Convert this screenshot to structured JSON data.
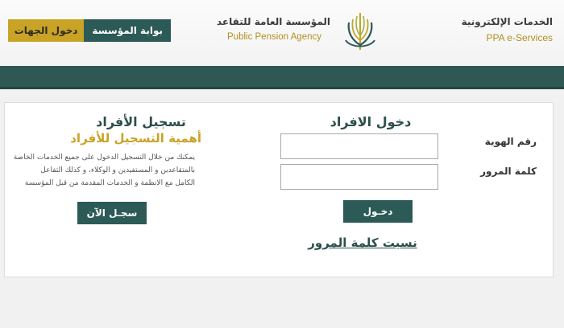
{
  "header": {
    "portal_label": "بوابة المؤسسة",
    "entities_login_label": "دخول الجهات",
    "agency_name_ar": "المؤسسة العامة للتقاعد",
    "agency_name_en": "Public Pension Agency",
    "eservices_ar": "الخدمات الإلكترونية",
    "eservices_en": "PPA  e-Services",
    "logo_icon": "palm-leaves-icon"
  },
  "login": {
    "title": "دخول الافراد",
    "id_label": "رقم الهوية",
    "id_value": "",
    "password_label": "كلمة المرور",
    "password_value": "",
    "submit_label": "دخـول",
    "forgot_label": "نسيت كلمة المرور"
  },
  "register": {
    "title": "تسجيل الأفراد",
    "subtitle": "أهمية التسجيل للأفراد",
    "description_lines": [
      "يمكنك من خلال التسجيل الدخول على جميع الخدمات الخاصة",
      "بالمتقاعدين و المستفيدين و الوكلاء، و كذلك التفاعل",
      "الكامل مع الانظمة و الخدمات المقدمة من قبل المؤسسة"
    ],
    "button_label": "سجـل الآن"
  },
  "colors": {
    "primary": "#2c5a56",
    "accent_gold": "#c9a326",
    "nav_bar": "#2f5753"
  }
}
